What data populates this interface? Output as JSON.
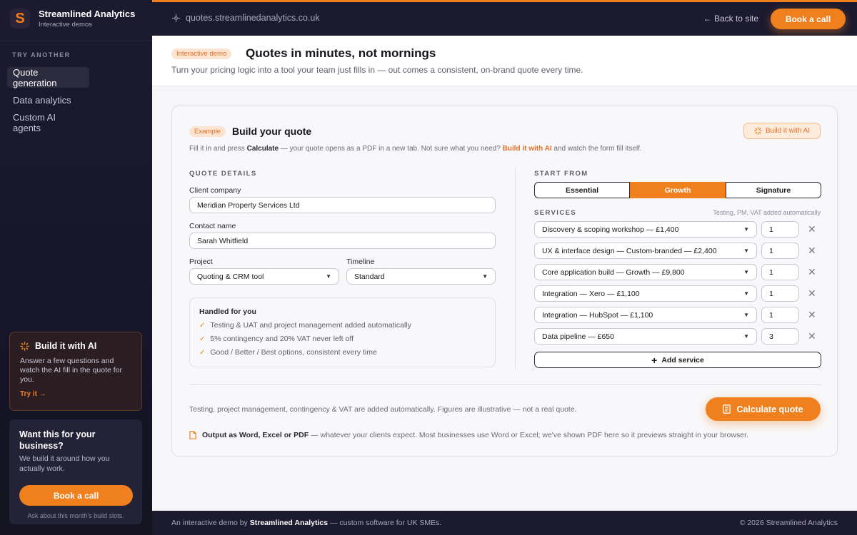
{
  "brand": {
    "logo_letter": "S",
    "name": "Streamlined Analytics",
    "subtitle": "Interactive demos"
  },
  "sidebar": {
    "section_label": "TRY ANOTHER",
    "items": [
      {
        "label": "Quote generation",
        "active": true
      },
      {
        "label": "Data analytics",
        "active": false
      },
      {
        "label": "Custom AI agents",
        "active": false
      }
    ],
    "ai_card": {
      "title": "Build it with AI",
      "text": "Answer a few questions and watch the AI fill in the quote for you.",
      "link": "Try it →"
    },
    "cta_card": {
      "title": "Want this for your business?",
      "text": "We build it around how you actually work.",
      "button": "Book a call",
      "note": "Ask about this month's build slots."
    }
  },
  "topbar": {
    "url": "quotes.streamlinedanalytics.co.uk",
    "back_link": "← Back to site",
    "book_button": "Book a call"
  },
  "header": {
    "badge": "Interactive demo",
    "title": "Quotes in minutes, not mornings",
    "subtitle": "Turn your pricing logic into a tool your team just fills in — out comes a consistent, on-brand quote every time."
  },
  "card": {
    "badge": "Example",
    "title": "Build your quote",
    "ai_button": "Build it with AI",
    "desc_pre": "Fill it in and press ",
    "desc_calc": "Calculate",
    "desc_mid": " — your quote opens as a PDF in a new tab. Not sure what you need? ",
    "desc_ai": "Build it with AI",
    "desc_post": " and watch the form fill itself."
  },
  "quote_details": {
    "section_label": "QUOTE DETAILS",
    "client_company_label": "Client company",
    "client_company_value": "Meridian Property Services Ltd",
    "contact_name_label": "Contact name",
    "contact_name_value": "Sarah Whitfield",
    "project_label": "Project",
    "project_value": "Quoting & CRM tool",
    "timeline_label": "Timeline",
    "timeline_value": "Standard"
  },
  "handled": {
    "title": "Handled for you",
    "items": [
      "Testing & UAT and project management added automatically",
      "5% contingency and 20% VAT never left off",
      "Good / Better / Best options, consistent every time"
    ]
  },
  "start_from": {
    "section_label": "START FROM",
    "options": [
      "Essential",
      "Growth",
      "Signature"
    ],
    "selected": "Growth"
  },
  "services": {
    "section_label": "SERVICES",
    "note": "Testing, PM, VAT added automatically",
    "rows": [
      {
        "service": "Discovery & scoping workshop — £1,400",
        "qty": "1"
      },
      {
        "service": "UX & interface design — Custom-branded — £2,400",
        "qty": "1"
      },
      {
        "service": "Core application build — Growth — £9,800",
        "qty": "1"
      },
      {
        "service": "Integration — Xero — £1,100",
        "qty": "1"
      },
      {
        "service": "Integration — HubSpot — £1,100",
        "qty": "1"
      },
      {
        "service": "Data pipeline — £650",
        "qty": "3"
      }
    ],
    "add_button": "Add service"
  },
  "bottom": {
    "footnote": "Testing, project management, contingency & VAT are added automatically. Figures are illustrative — not a real quote.",
    "calculate_button": "Calculate quote",
    "output_bold": "Output as Word, Excel or PDF",
    "output_rest": " — whatever your clients expect. Most businesses use Word or Excel; we've shown PDF here so it previews straight in your browser."
  },
  "footer": {
    "left_pre": "An interactive demo by ",
    "left_brand": "Streamlined Analytics",
    "left_post": " — custom software for UK SMEs.",
    "right": "© 2026 Streamlined Analytics"
  },
  "colors": {
    "accent": "#f07f1e",
    "sidebar_bg": "#1c1a2e",
    "badge_bg": "#fde4d0"
  }
}
